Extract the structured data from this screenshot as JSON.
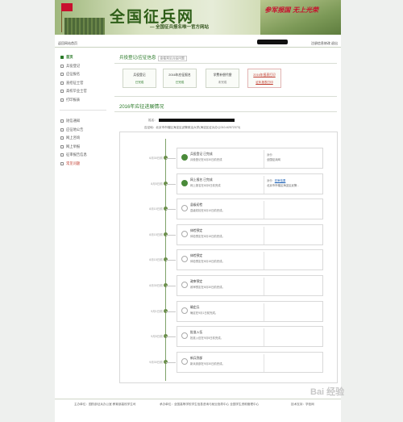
{
  "header": {
    "site_title": "全国征兵网",
    "subtitle": "— 全国征兵报名唯一官方网站",
    "slogan": "参军报国 无上光荣"
  },
  "topbar": {
    "home_link": "返回网站首页",
    "links": "注册信息修改  退出"
  },
  "sidebar": {
    "items_top": [
      {
        "label": "首页",
        "active": true
      },
      {
        "label": "兵役登记"
      },
      {
        "label": "应征报名"
      },
      {
        "label": "直招征士官"
      },
      {
        "label": "高校毕业士官"
      },
      {
        "label": "打印报表"
      }
    ],
    "items_bottom": [
      {
        "label": "短信通知"
      },
      {
        "label": "应征地公告"
      },
      {
        "label": "网上咨询"
      },
      {
        "label": "网上举报"
      },
      {
        "label": "征审报告信息"
      },
      {
        "label": "常见问题",
        "highlight": true
      }
    ]
  },
  "main": {
    "section_title": "兵役登记/应征信息",
    "section_note": "查看常见兵役问题",
    "tiles": [
      {
        "title": "兵役登记",
        "value": "已完成"
      },
      {
        "title": "2016年应征报名",
        "value": "已完成"
      },
      {
        "title": "学费补偿代偿",
        "value": "未完成"
      },
      {
        "title": "2016年报表打印",
        "value": "征年报表打印",
        "red": true
      }
    ],
    "progress_title": "2016年应征进展情况",
    "name_label": "姓名：",
    "address_label": "应征地：北京市市辖区海淀区武警政治大学(海淀区征兵办公010-62572373)"
  },
  "timeline": [
    {
      "date": "6月30日前",
      "title": "兵役登记 已完成",
      "desc": "兵役登记在6月30日前完成",
      "done": true,
      "right_label": "身份",
      "right_value": "全国征兵网"
    },
    {
      "date": "8月5日前",
      "title": "网上报名 已完成",
      "desc": "网上报名在8月5日前完成",
      "done": true,
      "right_label": "身份",
      "right_link": "初审结果",
      "right_value": "北京市市辖区海淀区武警..."
    },
    {
      "date": "8月10日前",
      "title": "县级初检",
      "desc": "县级初检在8月10日前完成。"
    },
    {
      "date": "8月15日前",
      "title": "体检预定",
      "desc": "体检预定在8月15日前完成。"
    },
    {
      "date": "8月15日前",
      "title": "体检预定",
      "desc": "体检预定在8月15日前完成。"
    },
    {
      "date": "8月30日前",
      "title": "政审预定",
      "desc": "政审预定在8月30日前完成。"
    },
    {
      "date": "9月1日前",
      "title": "确定兵",
      "desc": "确定在9月1日前完成。"
    },
    {
      "date": "9月5日前",
      "title": "批准入伍",
      "desc": "批准入伍在9月5日前完成。"
    },
    {
      "date": "9月30日前",
      "title": "新兵到部",
      "desc": "新兵到部在9月30日前完成。"
    }
  ],
  "footer": {
    "sponsor": "主办单位：国防部征兵办公室  教育部高校学生司",
    "support": "承办单位：全国高等学校学生信息咨询与就业指导中心  全国学生资助管理中心",
    "tech": "技术支持：学信网"
  },
  "watermark": "Bai 经验"
}
